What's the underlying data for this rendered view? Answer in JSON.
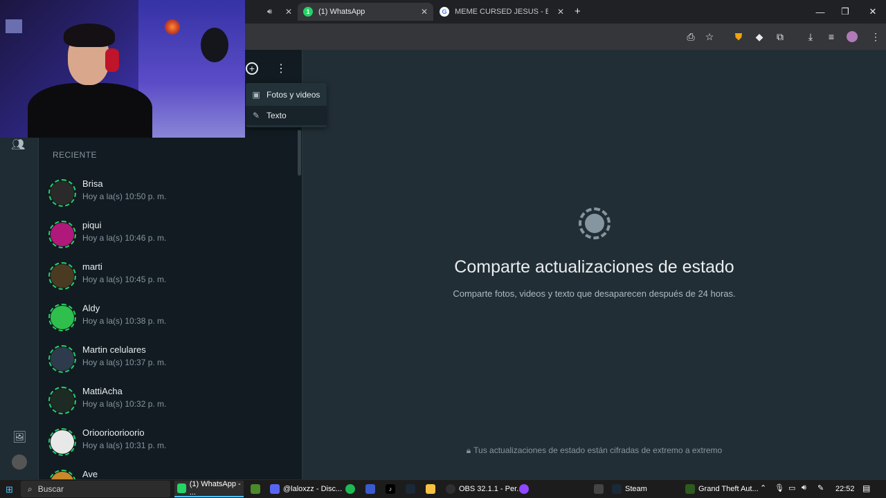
{
  "browser": {
    "tabs": [
      {
        "label": "",
        "close": "✕"
      },
      {
        "label": "(1) WhatsApp",
        "badge": "1",
        "close": "✕"
      },
      {
        "label": "MEME CURSED JESUS - Buscar",
        "close": "✕"
      }
    ],
    "new_tab": "+",
    "window": {
      "minimize": "—",
      "maximize": "❐",
      "close": "✕"
    }
  },
  "status_panel": {
    "menu": {
      "items": [
        {
          "label": "Fotos y videos"
        },
        {
          "label": "Texto"
        }
      ]
    },
    "section_label": "RECIENTE",
    "statuses": [
      {
        "name": "Brisa",
        "time": "Hoy a la(s) 10:50 p. m.",
        "color": "#2a2a2a"
      },
      {
        "name": "piqui",
        "time": "Hoy a la(s) 10:46 p. m.",
        "color": "#b0187a"
      },
      {
        "name": "marti",
        "time": "Hoy a la(s) 10:45 p. m.",
        "color": "#4a3a22"
      },
      {
        "name": "Aldy",
        "time": "Hoy a la(s) 10:38 p. m.",
        "color": "#2fbf4c"
      },
      {
        "name": "Martin celulares",
        "time": "Hoy a la(s) 10:37 p. m.",
        "color": "#2d3b4c"
      },
      {
        "name": "MattiAcha",
        "time": "Hoy a la(s) 10:32 p. m.",
        "color": "#1e2a24"
      },
      {
        "name": "Orioorioorioorio",
        "time": "Hoy a la(s) 10:31 p. m.",
        "color": "#e8e8e8"
      },
      {
        "name": "Ave",
        "time": "",
        "color": "#c9882a"
      }
    ]
  },
  "main": {
    "title": "Comparte actualizaciones de estado",
    "subtitle": "Comparte fotos, videos y texto que desaparecen después de 24 horas.",
    "encryption_note": "Tus actualizaciones de estado están cifradas de extremo a extremo"
  },
  "taskbar": {
    "search_placeholder": "Buscar",
    "apps": [
      {
        "label": "(1) WhatsApp - ..."
      },
      {
        "label": "@laloxzz - Disc..."
      },
      {
        "label": "OBS 32.1.1 - Per..."
      },
      {
        "label": "Steam"
      },
      {
        "label": "Grand Theft Aut..."
      }
    ],
    "clock": "22:52"
  }
}
